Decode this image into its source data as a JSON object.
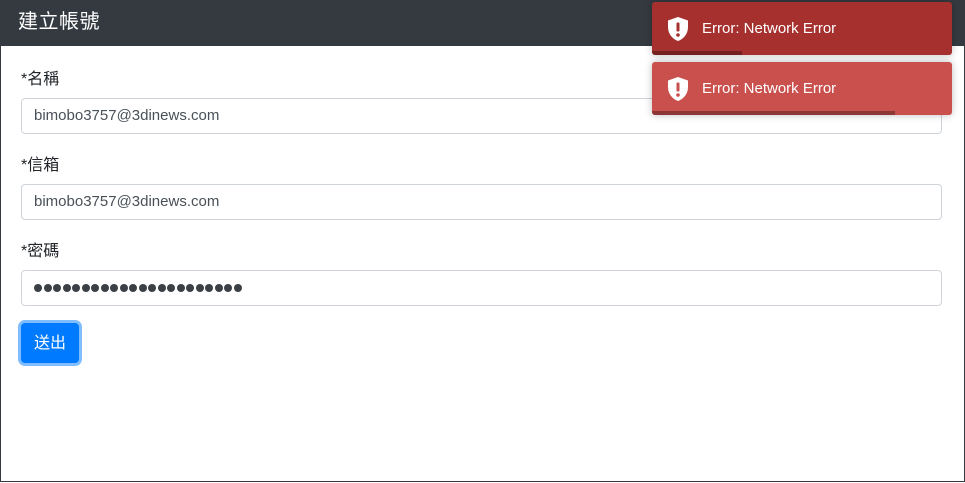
{
  "header": {
    "title": "建立帳號"
  },
  "form": {
    "name_label": "*名稱",
    "name_value": "bimobo3757@3dinews.com",
    "email_label": "*信箱",
    "email_value": "bimobo3757@3dinews.com",
    "password_label": "*密碼",
    "password_mask_length": 22,
    "submit_label": "送出"
  },
  "toasts": [
    {
      "message": "Error: Network Error",
      "icon": "shield-exclamation-icon",
      "color": "#a6302e",
      "progress": 0.3
    },
    {
      "message": "Error: Network Error",
      "icon": "shield-exclamation-icon",
      "color": "#c9504d",
      "progress": 0.81
    }
  ],
  "colors": {
    "header_bg": "#343a40",
    "primary": "#007bff"
  }
}
